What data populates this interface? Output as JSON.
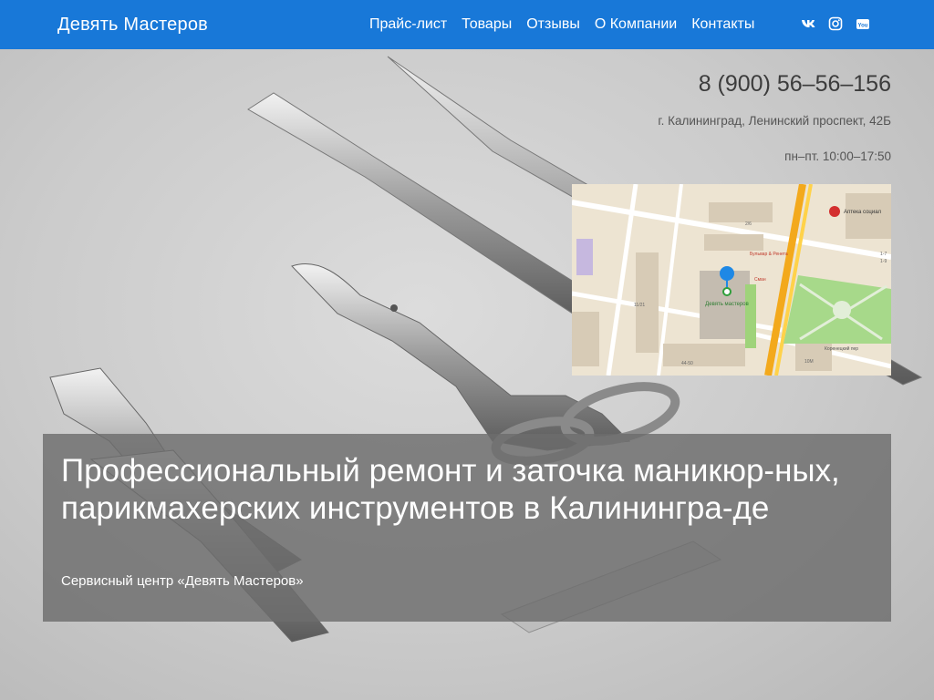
{
  "header": {
    "brand": "Девять Мастеров",
    "nav": [
      "Прайс-лист",
      "Товары",
      "Отзывы",
      "О Компании",
      "Контакты"
    ],
    "social": [
      "vk-icon",
      "instagram-icon",
      "youtube-icon"
    ],
    "color": "#1878d8"
  },
  "contact": {
    "phone": "8 (900) 56–56–156",
    "address": "г. Калининград, Ленинский проспект, 42Б",
    "hours": "пн–пт. 10:00–17:50"
  },
  "map": {
    "pin_label": "Девять мастеров",
    "labels": [
      "Аптека социал",
      "Бульвар & Ренета",
      "Сман",
      "Коренецкий пер",
      "11/21",
      "44-50",
      "2/6",
      "10М",
      "1-7",
      "1-9"
    ]
  },
  "banner": {
    "title": "Профессиональный ремонт и заточка маникюр-ных, парикмахерских инструментов в Калинингра-де",
    "subtitle": "Сервисный центр «Девять Мастеров»"
  }
}
